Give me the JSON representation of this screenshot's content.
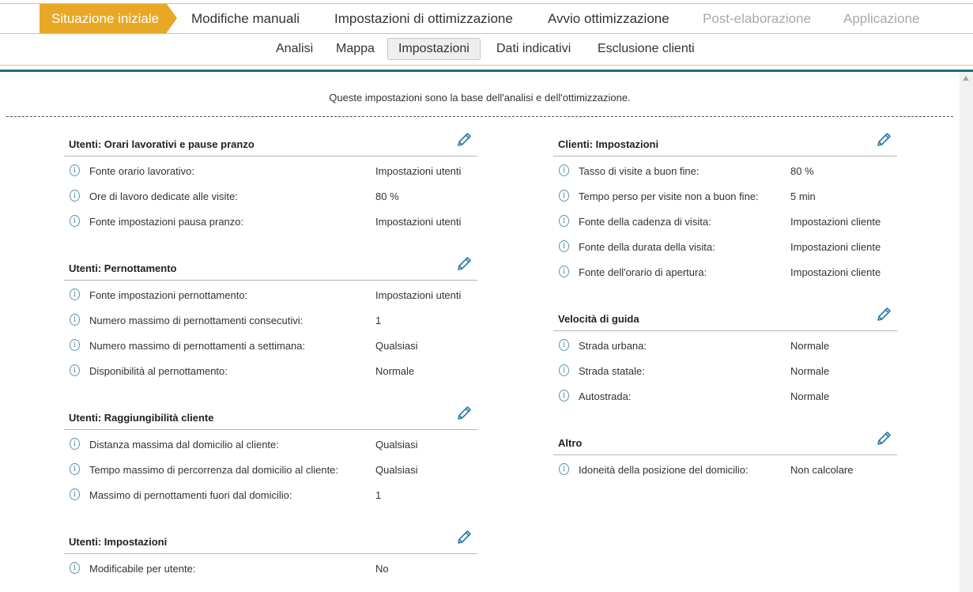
{
  "steps": [
    {
      "label": "Situazione iniziale",
      "state": "active"
    },
    {
      "label": "Modifiche manuali",
      "state": "normal"
    },
    {
      "label": "Impostazioni di ottimizzazione",
      "state": "normal"
    },
    {
      "label": "Avvio ottimizzazione",
      "state": "normal"
    },
    {
      "label": "Post-elaborazione",
      "state": "disabled"
    },
    {
      "label": "Applicazione",
      "state": "disabled"
    }
  ],
  "subtabs": [
    {
      "label": "Analisi"
    },
    {
      "label": "Mappa"
    },
    {
      "label": "Impostazioni",
      "active": true
    },
    {
      "label": "Dati indicativi"
    },
    {
      "label": "Esclusione clienti"
    }
  ],
  "intro": "Queste impostazioni sono la base dell'analisi e dell'ottimizzazione.",
  "info_icon": "info-circle-icon",
  "edit_icon": "pencil-icon",
  "colors": {
    "accent": "#e8a826",
    "teal": "#1f6d80",
    "icon": "#2a7aa6"
  },
  "left_sections": [
    {
      "title": "Utenti: Orari lavorativi e pause pranzo",
      "rows": [
        {
          "label": "Fonte orario lavorativo:",
          "value": "Impostazioni utenti"
        },
        {
          "label": "Ore di lavoro dedicate alle visite:",
          "value": "80 %"
        },
        {
          "label": "Fonte impostazioni pausa pranzo:",
          "value": "Impostazioni utenti"
        }
      ]
    },
    {
      "title": "Utenti: Pernottamento",
      "rows": [
        {
          "label": "Fonte impostazioni pernottamento:",
          "value": "Impostazioni utenti"
        },
        {
          "label": "Numero massimo di pernottamenti consecutivi:",
          "value": "1"
        },
        {
          "label": "Numero massimo di pernottamenti a settimana:",
          "value": "Qualsiasi"
        },
        {
          "label": "Disponibilità al pernottamento:",
          "value": "Normale"
        }
      ]
    },
    {
      "title": "Utenti: Raggiungibilità cliente",
      "rows": [
        {
          "label": "Distanza massima dal domicilio al cliente:",
          "value": "Qualsiasi"
        },
        {
          "label": "Tempo massimo di percorrenza dal domicilio al cliente:",
          "value": "Qualsiasi"
        },
        {
          "label": "Massimo di pernottamenti fuori dal domicilio:",
          "value": "1"
        }
      ]
    },
    {
      "title": "Utenti: Impostazioni",
      "rows": [
        {
          "label": "Modificabile per utente:",
          "value": "No"
        }
      ]
    }
  ],
  "right_sections": [
    {
      "title": "Clienti: Impostazioni",
      "rows": [
        {
          "label": "Tasso di visite a buon fine:",
          "value": "80 %"
        },
        {
          "label": "Tempo perso per visite non a buon fine:",
          "value": "5 min"
        },
        {
          "label": "Fonte della cadenza di visita:",
          "value": "Impostazioni cliente"
        },
        {
          "label": "Fonte della durata della visita:",
          "value": "Impostazioni cliente"
        },
        {
          "label": "Fonte dell'orario di apertura:",
          "value": "Impostazioni cliente"
        }
      ]
    },
    {
      "title": "Velocità di guida",
      "rows": [
        {
          "label": "Strada urbana:",
          "value": "Normale"
        },
        {
          "label": "Strada statale:",
          "value": "Normale"
        },
        {
          "label": "Autostrada:",
          "value": "Normale"
        }
      ]
    },
    {
      "title": "Altro",
      "rows": [
        {
          "label": "Idoneità della posizione del domicilio:",
          "value": "Non calcolare"
        }
      ]
    }
  ]
}
